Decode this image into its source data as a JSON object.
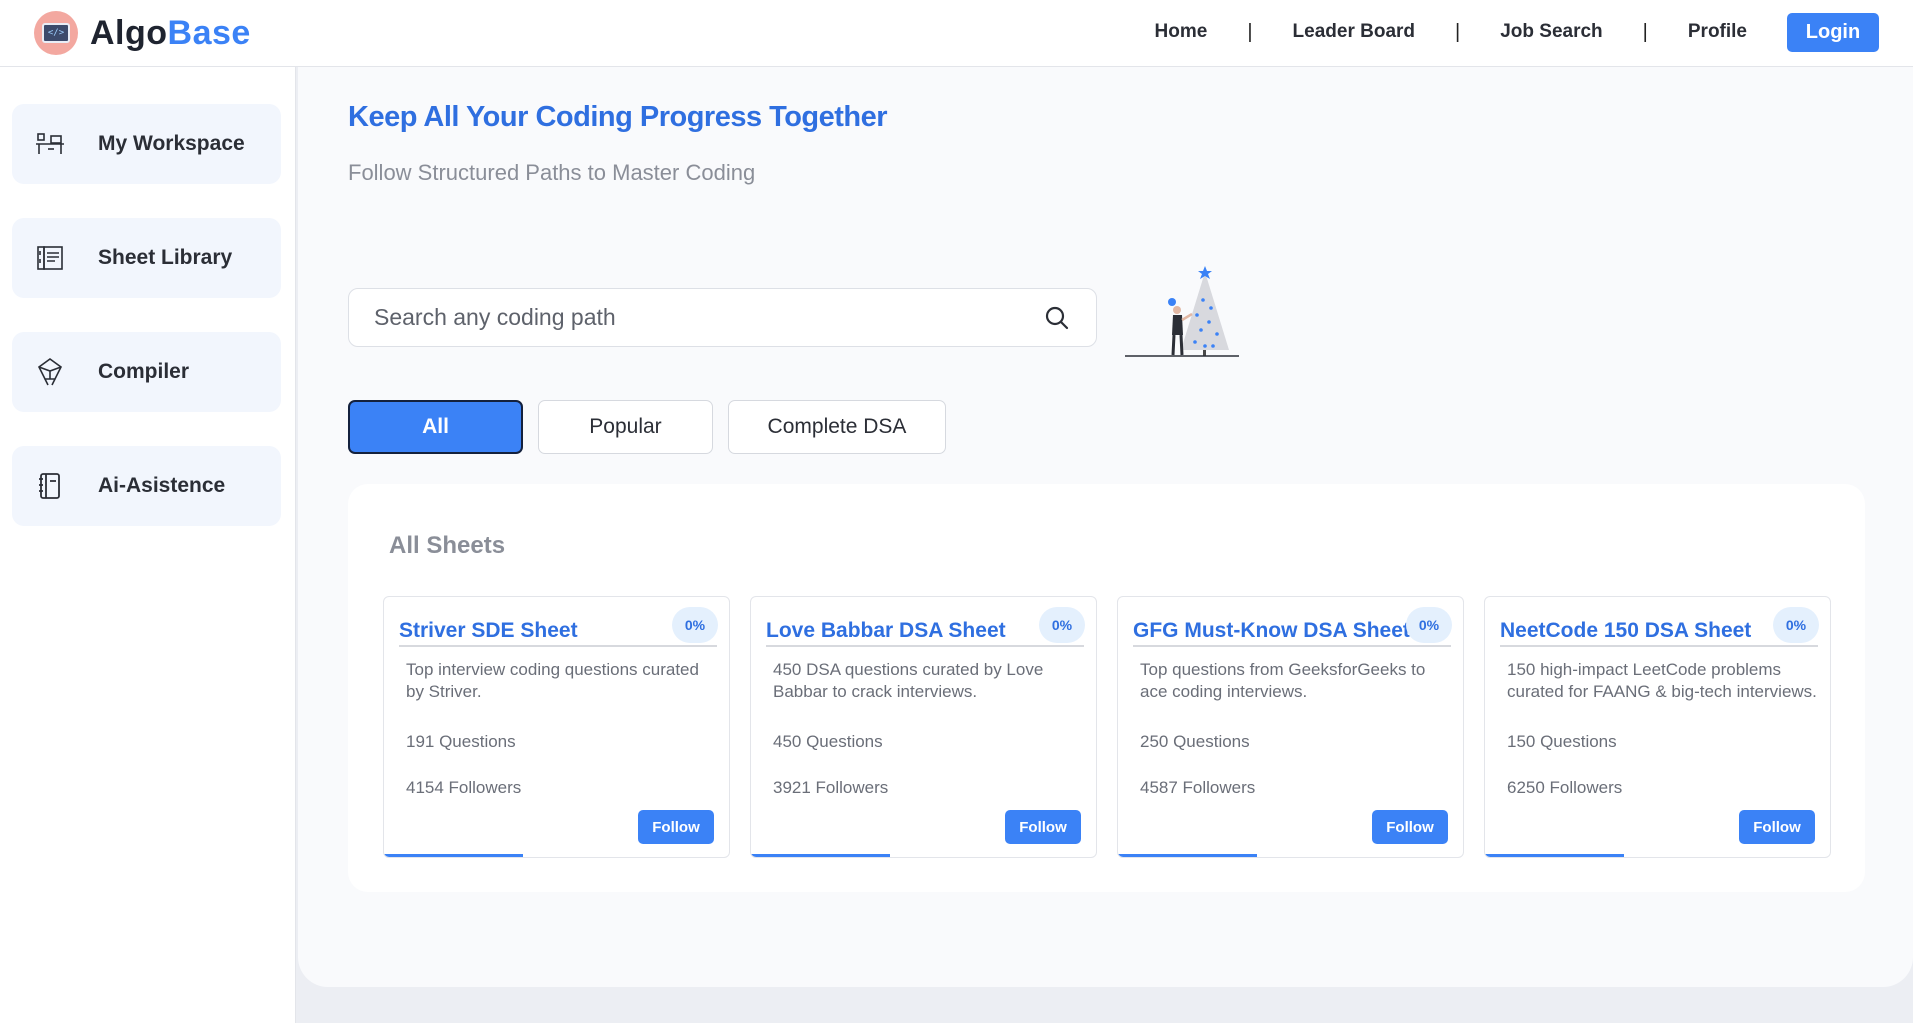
{
  "brand": {
    "name_part1": "Algo",
    "name_part2": "Base",
    "colors": {
      "primary": "#3b82f6",
      "dark": "#1f2430"
    }
  },
  "nav": {
    "items": [
      "Home",
      "Leader Board",
      "Job Search",
      "Profile"
    ],
    "separator": "|",
    "login_label": "Login"
  },
  "sidebar": {
    "items": [
      {
        "label": "My Workspace",
        "icon": "workspace-icon"
      },
      {
        "label": "Sheet Library",
        "icon": "library-icon"
      },
      {
        "label": "Compiler",
        "icon": "compiler-icon"
      },
      {
        "label": "Ai-Asistence",
        "icon": "notebook-icon"
      }
    ]
  },
  "main": {
    "title": "Keep All Your Coding Progress Together",
    "subtitle": "Follow Structured Paths to Master Coding",
    "search": {
      "placeholder": "Search any coding path",
      "icon": "search-icon"
    },
    "illustration": "christmas-tree-illustration",
    "filters": [
      {
        "label": "All",
        "active": true
      },
      {
        "label": "Popular",
        "active": false
      },
      {
        "label": "Complete DSA",
        "active": false
      }
    ],
    "panel_title": "All Sheets",
    "follow_label": "Follow",
    "cards": [
      {
        "title": "Striver SDE Sheet",
        "progress": "0%",
        "description": "Top interview coding questions curated by Striver.",
        "questions": "191 Questions",
        "followers": "4154 Followers"
      },
      {
        "title": "Love Babbar DSA Sheet",
        "progress": "0%",
        "description": "450 DSA questions curated by Love Babbar to crack interviews.",
        "questions": "450 Questions",
        "followers": "3921 Followers"
      },
      {
        "title": "GFG Must-Know DSA Sheet",
        "progress": "0%",
        "description": "Top questions from GeeksforGeeks to ace coding interviews.",
        "questions": "250 Questions",
        "followers": "4587 Followers"
      },
      {
        "title": "NeetCode 150 DSA Sheet",
        "progress": "0%",
        "description": "150 high-impact LeetCode problems curated for FAANG & big-tech interviews.",
        "questions": "150 Questions",
        "followers": "6250 Followers"
      }
    ]
  }
}
